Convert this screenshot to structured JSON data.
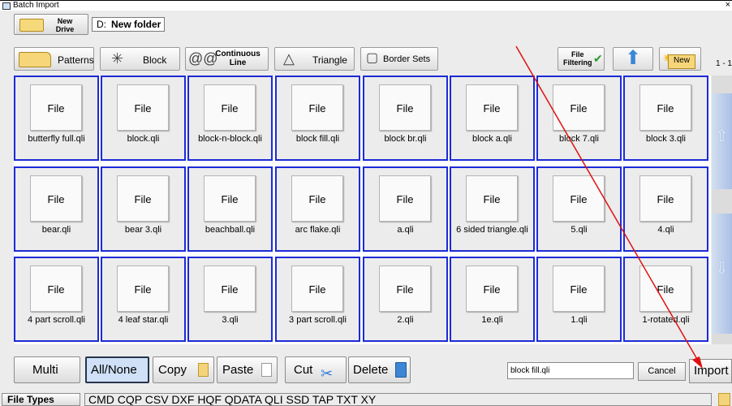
{
  "window": {
    "title": "Batch Import",
    "close_glyph": "×"
  },
  "drive": {
    "new_drive_line1": "New",
    "new_drive_line2": "Drive",
    "drive_letter": "D:",
    "folder": "New folder"
  },
  "toolbar": {
    "patterns": "Patterns",
    "block": "Block",
    "continuous_line1": "Continuous",
    "continuous_line2": "Line",
    "triangle": "Triangle",
    "border_sets": "Border Sets",
    "file_filtering_line1": "File",
    "file_filtering_line2": "Filtering",
    "new": "New",
    "range": "1 - 1"
  },
  "grid": {
    "thumb_label": "File",
    "files": [
      "butterfly full.qli",
      "block.qli",
      "block-n-block.qli",
      "block fill.qli",
      "block br.qli",
      "block a.qli",
      "block 7.qli",
      "block 3.qli",
      "bear.qli",
      "bear 3.qli",
      "beachball.qli",
      "arc flake.qli",
      "a.qli",
      "6 sided triangle.qli",
      "5.qli",
      "4.qli",
      "4 part scroll.qli",
      "4 leaf star.qli",
      "3.qli",
      "3 part scroll.qli",
      "2.qli",
      "1e.qli",
      "1.qli",
      "1-rotated.qli"
    ]
  },
  "actions": {
    "multi": "Multi",
    "all_none": "All/None",
    "copy": "Copy",
    "paste": "Paste",
    "cut": "Cut",
    "delete": "Delete",
    "filename": "block fill.qli",
    "cancel": "Cancel",
    "import": "Import"
  },
  "file_types": {
    "label": "File Types",
    "list": "CMD CQP CSV DXF HQF QDATA QLI SSD TAP TXT XY"
  },
  "colors": {
    "cell_border": "#1c2bd6",
    "annotation_arrow": "#e01010"
  }
}
